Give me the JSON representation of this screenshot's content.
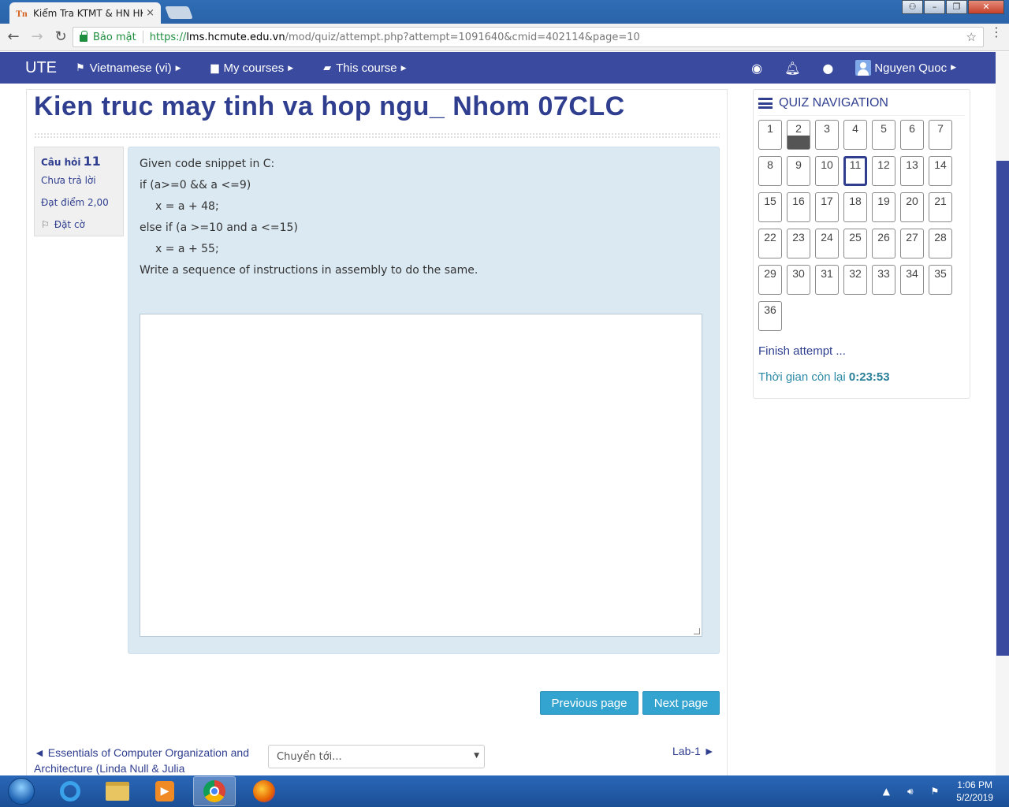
{
  "browser": {
    "tab_title": "Kiểm Tra KTMT & HN HK",
    "tab_close": "×",
    "secure_label": "Bảo mật",
    "url_scheme": "https://",
    "url_host": "lms.hcmute.edu.vn",
    "url_path": "/mod/quiz/attempt.php?attempt=1091640&cmid=402114&page=10"
  },
  "navbar": {
    "brand": "UTE",
    "language": "Vietnamese (vi)",
    "my_courses": "My courses",
    "this_course": "This course",
    "user_name": "Nguyen Quoc"
  },
  "course": {
    "title": "Kien truc may tinh va hop ngu_ Nhom 07CLC"
  },
  "question": {
    "label": "Câu hỏi",
    "number": "11",
    "state": "Chưa trả lời",
    "grade": "Đạt điểm 2,00",
    "flag": "Đặt cờ",
    "lines": {
      "l1": "Given code snippet in C:",
      "l2": "if (a>=0 && a <=9)",
      "l3": "x = a + 48;",
      "l4": "else if (a >=10 and a <=15)",
      "l5": "x = a + 55;",
      "l6": "Write a sequence of instructions in assembly to do the same."
    },
    "answer_value": ""
  },
  "buttons": {
    "previous": "Previous page",
    "next": "Next page"
  },
  "activity_nav": {
    "prev": "◄ Essentials of Computer Organization and Architecture (Linda Null & Julia",
    "jump_placeholder": "Chuyển tới...",
    "next": "Lab-1 ►"
  },
  "quiz_nav": {
    "heading": "QUIZ NAVIGATION",
    "questions": [
      "1",
      "2",
      "3",
      "4",
      "5",
      "6",
      "7",
      "8",
      "9",
      "10",
      "11",
      "12",
      "13",
      "14",
      "15",
      "16",
      "17",
      "18",
      "19",
      "20",
      "21",
      "22",
      "23",
      "24",
      "25",
      "26",
      "27",
      "28",
      "29",
      "30",
      "31",
      "32",
      "33",
      "34",
      "35",
      "36"
    ],
    "answered": [
      "2"
    ],
    "current": "11",
    "finish": "Finish attempt ...",
    "time_label": "Thời gian còn lại",
    "time_value": "0:23:53"
  },
  "taskbar": {
    "time": "1:06 PM",
    "date": "5/2/2019"
  },
  "colors": {
    "navbar": "#3a4a9e",
    "title": "#2f3e8f",
    "question_bg": "#dbe9f3",
    "button": "#33a3cf"
  }
}
